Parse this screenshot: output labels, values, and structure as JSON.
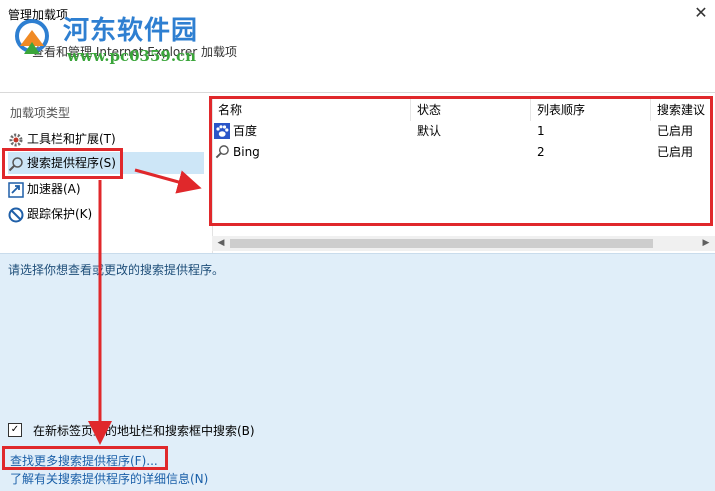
{
  "window": {
    "title": "管理加载项",
    "header_description": "查看和管理 Internet Explorer 加载项"
  },
  "watermark": {
    "name": "河东软件园",
    "url": "www.pc0359.cn"
  },
  "sidebar": {
    "title": "加载项类型",
    "items": [
      {
        "label": "工具栏和扩展(T)",
        "icon": "gear-icon"
      },
      {
        "label": "搜索提供程序(S)",
        "icon": "search-icon"
      },
      {
        "label": "加速器(A)",
        "icon": "accelerator-icon"
      },
      {
        "label": "跟踪保护(K)",
        "icon": "no-tracking-icon"
      }
    ],
    "selected": "搜索提供程序(S)"
  },
  "table": {
    "columns": [
      "名称",
      "状态",
      "列表顺序",
      "搜索建议"
    ],
    "rows": [
      {
        "name": "百度",
        "status": "默认",
        "order": "1",
        "suggest": "已启用",
        "icon": "baidu-paw-icon"
      },
      {
        "name": "Bing",
        "status": "",
        "order": "2",
        "suggest": "已启用",
        "icon": "search-icon"
      }
    ]
  },
  "details": {
    "prompt": "请选择你想查看或更改的搜索提供程序。",
    "checkbox_label": "在新标签页上的地址栏和搜索框中搜索(B)",
    "checkbox_checked": true
  },
  "footer": {
    "find_more_link": "查找更多搜索提供程序(F)...",
    "learn_more_link": "了解有关搜索提供程序的详细信息(N)"
  },
  "colors": {
    "selection": "#cde6f7",
    "details_bg": "#e0eef9",
    "link": "#1a5fa8",
    "annotation": "#e0282b"
  }
}
